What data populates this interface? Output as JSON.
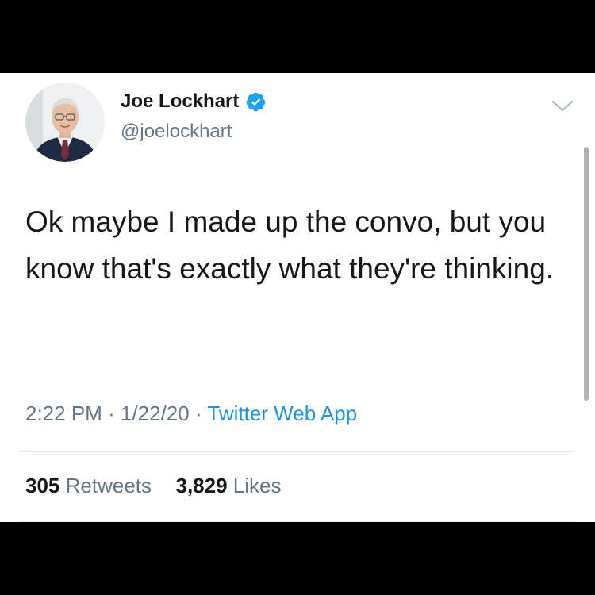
{
  "author": {
    "name": "Joe Lockhart",
    "handle": "@joelockhart",
    "verified": true,
    "avatar_icon": "user-avatar-photo"
  },
  "tweet": {
    "text": "Ok maybe I made up the convo, but you know that's exactly what they're thinking.",
    "time": "2:22 PM",
    "separator": "·",
    "date": "1/22/20",
    "source": "Twitter Web App"
  },
  "stats": {
    "retweets_count": "305",
    "retweets_label": "Retweets",
    "likes_count": "3,829",
    "likes_label": "Likes"
  },
  "colors": {
    "background": "#000000",
    "card": "#ffffff",
    "text": "#14171a",
    "secondary_text": "#657786",
    "link": "#1b95e0",
    "verified": "#1da1f2",
    "divider": "#e1e8ed"
  },
  "icons": {
    "verified": "verified-badge-icon",
    "menu": "chevron-down-icon"
  }
}
